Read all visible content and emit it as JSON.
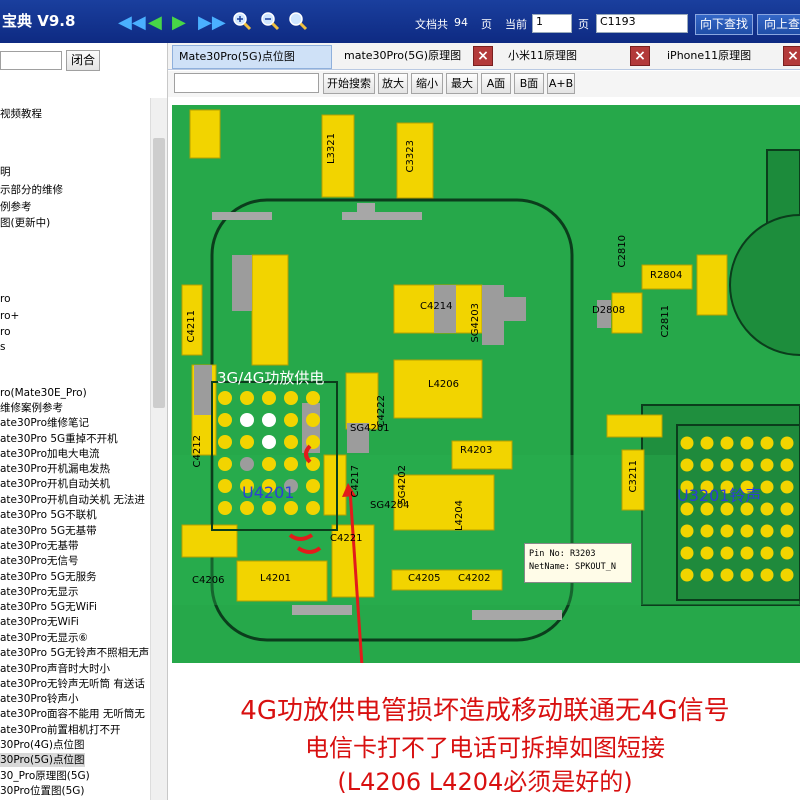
{
  "app": {
    "title": "宝典 V9.8"
  },
  "toolbar": {
    "doc_total_label": "文档共",
    "doc_total": "94",
    "page_unit_label": "页",
    "current_label": "当前",
    "current_page": "1",
    "page_label2": "页",
    "search_value": "C1193",
    "find_next_label": "向下查找",
    "find_prev_label": "向上查"
  },
  "left": {
    "close_label": "闭合",
    "tree": [
      "视频教程",
      "明",
      "示部分的维修",
      "例参考",
      "图(更新中)",
      "ro",
      "ro+",
      "ro",
      "s",
      "ro(Mate30E_Pro)",
      "维修案例参考",
      "ate30Pro维修笔记",
      "ate30Pro 5G重掉不开机",
      "ate30Pro加电大电流",
      "ate30Pro开机漏电发热",
      "ate30Pro开机自动关机",
      "ate30Pro开机自动关机 无法进",
      "ate30Pro 5G不联机",
      "ate30Pro 5G无基带",
      "ate30Pro无基带",
      "ate30Pro无信号",
      "ate30Pro 5G无服务",
      "ate30Pro无显示",
      "ate30Pro 5G无WiFi",
      "ate30Pro无WiFi",
      "ate30Pro无显示⑥",
      "ate30Pro 5G无铃声不照相无声",
      "ate30Pro声音时大时小",
      "ate30Pro无铃声无听筒 有送话",
      "ate30Pro铃声小",
      "ate30Pro面容不能用 无听筒无",
      "ate30Pro前置相机打不开",
      "30Pro(4G)点位图",
      "30Pro(5G)点位图",
      "30_Pro原理图(5G)",
      "30Pro位置图(5G)"
    ]
  },
  "tabs": [
    {
      "label": "Mate30Pro(5G)点位图"
    },
    {
      "label": "mate30Pro(5G)原理图"
    },
    {
      "label": "小米11原理图"
    },
    {
      "label": "iPhone11原理图"
    }
  ],
  "tools": {
    "search_btn": "开始搜索",
    "zoom_in": "放大",
    "zoom_out": "缩小",
    "max": "最大",
    "a_side": "A面",
    "b_side": "B面",
    "ab_side": "A+B"
  },
  "board": {
    "power_label": "3G/4G功放供电",
    "chip_u4201": "U4201",
    "chip_u3201": "U3201铃声",
    "pin_no": "Pin No: R3203",
    "net_name": "NetName: SPKOUT_N",
    "refs": {
      "l3321": "L3321",
      "c3323": "C3323",
      "c2810": "C2810",
      "r2804": "R2804",
      "d2808": "D2808",
      "c2811": "C2811",
      "c4214": "C4214",
      "sg4203": "SG4203",
      "l4206": "L4206",
      "sg4201": "SG4201",
      "c4222": "C4222",
      "r4203": "R4203",
      "l4204": "L4204",
      "c4221": "C4221",
      "l4201": "L4201",
      "c4211": "C4211",
      "c4205": "C4205",
      "c4202": "C4202",
      "c3211": "C3211",
      "sg4202": "SG4202",
      "c4217": "C4217",
      "c4212": "C4212",
      "sg4204": "SG4204",
      "c4206": "C4206"
    }
  },
  "annotation": {
    "line1": "4G功放供电管损坏造成移动联通无4G信号",
    "line2": "电信卡打不了电话可拆掉如图短接",
    "line3": "(L4206 L4204必须是好的)"
  },
  "colors": {
    "pcb_green": "#26a84a",
    "pad_yellow": "#f2d400",
    "title_blue": "#0e2a82",
    "annotation_red": "#d81010",
    "chip_label_blue": "#2d3fd6"
  }
}
